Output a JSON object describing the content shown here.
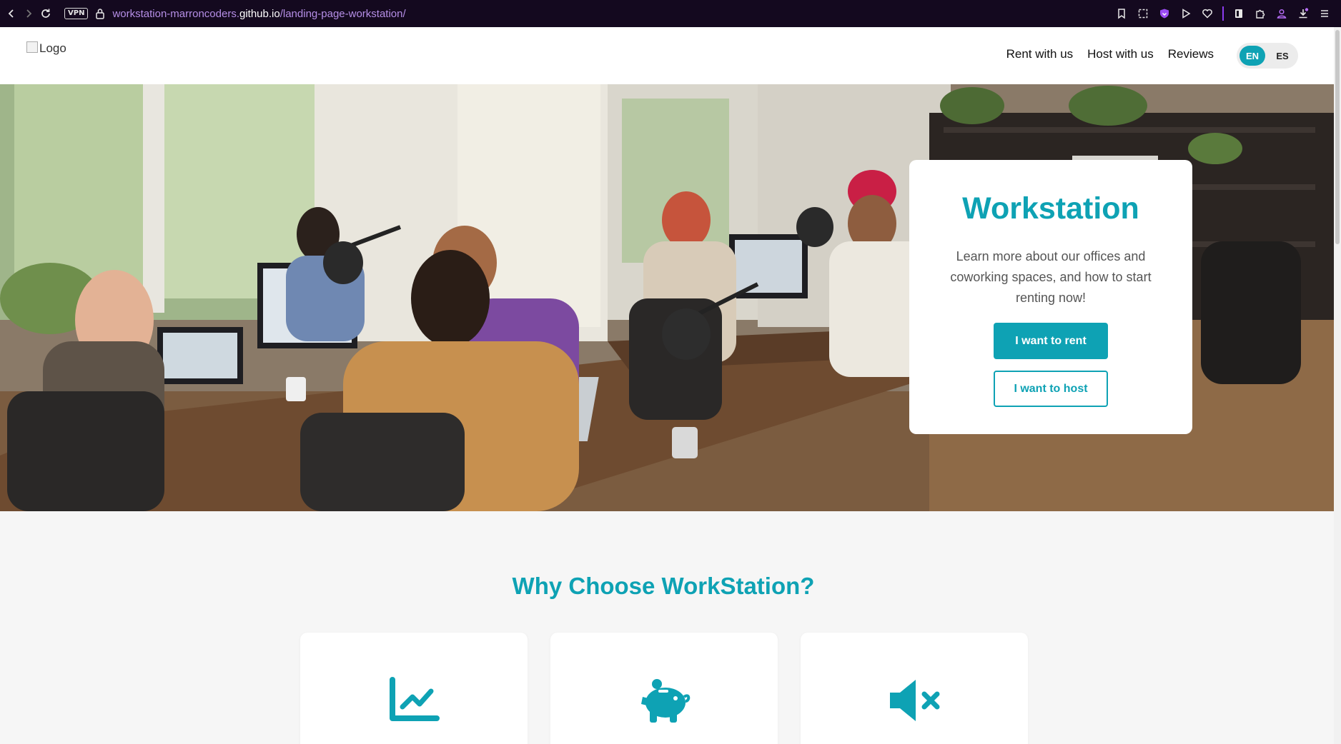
{
  "browser": {
    "url_prefix": "workstation-marroncoders.",
    "url_host": "github.io",
    "url_path": "/landing-page-workstation/",
    "vpn_label": "VPN"
  },
  "header": {
    "logo_alt": "Logo",
    "nav": [
      "Rent with us",
      "Host with us",
      "Reviews"
    ],
    "languages": [
      "EN",
      "ES"
    ],
    "active_language": "EN"
  },
  "hero": {
    "title": "Workstation",
    "description": "Learn more about our offices and coworking spaces, and how to start renting now!",
    "primary_button": "I want to rent",
    "secondary_button": "I want to host"
  },
  "why": {
    "title": "Why Choose WorkStation?",
    "features": [
      {
        "icon": "chart-line-icon"
      },
      {
        "icon": "piggy-bank-icon"
      },
      {
        "icon": "volume-mute-icon"
      }
    ]
  },
  "colors": {
    "accent": "#0ea2b4",
    "browser_bar": "#14091f",
    "url_purple": "#b58ee6"
  }
}
